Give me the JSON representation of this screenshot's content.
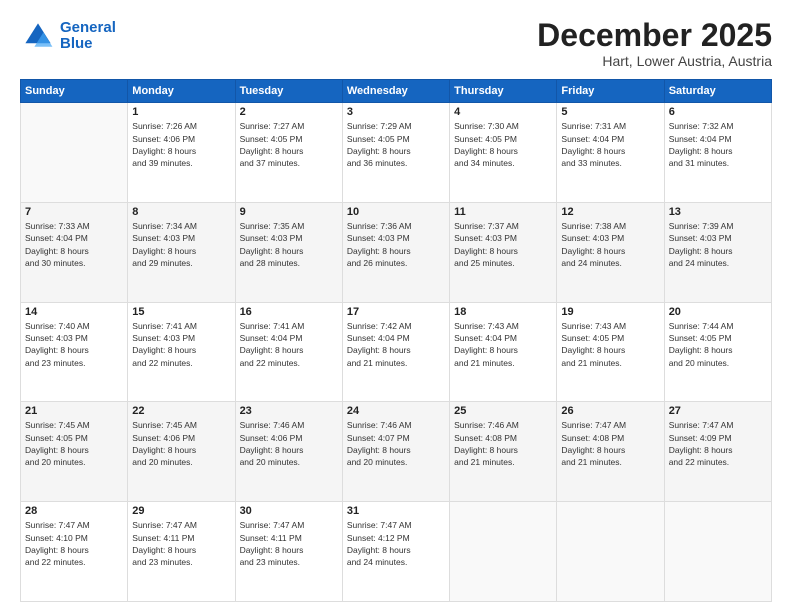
{
  "logo": {
    "line1": "General",
    "line2": "Blue"
  },
  "header": {
    "month": "December 2025",
    "location": "Hart, Lower Austria, Austria"
  },
  "weekdays": [
    "Sunday",
    "Monday",
    "Tuesday",
    "Wednesday",
    "Thursday",
    "Friday",
    "Saturday"
  ],
  "weeks": [
    [
      {
        "day": "",
        "info": ""
      },
      {
        "day": "1",
        "info": "Sunrise: 7:26 AM\nSunset: 4:06 PM\nDaylight: 8 hours\nand 39 minutes."
      },
      {
        "day": "2",
        "info": "Sunrise: 7:27 AM\nSunset: 4:05 PM\nDaylight: 8 hours\nand 37 minutes."
      },
      {
        "day": "3",
        "info": "Sunrise: 7:29 AM\nSunset: 4:05 PM\nDaylight: 8 hours\nand 36 minutes."
      },
      {
        "day": "4",
        "info": "Sunrise: 7:30 AM\nSunset: 4:05 PM\nDaylight: 8 hours\nand 34 minutes."
      },
      {
        "day": "5",
        "info": "Sunrise: 7:31 AM\nSunset: 4:04 PM\nDaylight: 8 hours\nand 33 minutes."
      },
      {
        "day": "6",
        "info": "Sunrise: 7:32 AM\nSunset: 4:04 PM\nDaylight: 8 hours\nand 31 minutes."
      }
    ],
    [
      {
        "day": "7",
        "info": "Sunrise: 7:33 AM\nSunset: 4:04 PM\nDaylight: 8 hours\nand 30 minutes."
      },
      {
        "day": "8",
        "info": "Sunrise: 7:34 AM\nSunset: 4:03 PM\nDaylight: 8 hours\nand 29 minutes."
      },
      {
        "day": "9",
        "info": "Sunrise: 7:35 AM\nSunset: 4:03 PM\nDaylight: 8 hours\nand 28 minutes."
      },
      {
        "day": "10",
        "info": "Sunrise: 7:36 AM\nSunset: 4:03 PM\nDaylight: 8 hours\nand 26 minutes."
      },
      {
        "day": "11",
        "info": "Sunrise: 7:37 AM\nSunset: 4:03 PM\nDaylight: 8 hours\nand 25 minutes."
      },
      {
        "day": "12",
        "info": "Sunrise: 7:38 AM\nSunset: 4:03 PM\nDaylight: 8 hours\nand 24 minutes."
      },
      {
        "day": "13",
        "info": "Sunrise: 7:39 AM\nSunset: 4:03 PM\nDaylight: 8 hours\nand 24 minutes."
      }
    ],
    [
      {
        "day": "14",
        "info": "Sunrise: 7:40 AM\nSunset: 4:03 PM\nDaylight: 8 hours\nand 23 minutes."
      },
      {
        "day": "15",
        "info": "Sunrise: 7:41 AM\nSunset: 4:03 PM\nDaylight: 8 hours\nand 22 minutes."
      },
      {
        "day": "16",
        "info": "Sunrise: 7:41 AM\nSunset: 4:04 PM\nDaylight: 8 hours\nand 22 minutes."
      },
      {
        "day": "17",
        "info": "Sunrise: 7:42 AM\nSunset: 4:04 PM\nDaylight: 8 hours\nand 21 minutes."
      },
      {
        "day": "18",
        "info": "Sunrise: 7:43 AM\nSunset: 4:04 PM\nDaylight: 8 hours\nand 21 minutes."
      },
      {
        "day": "19",
        "info": "Sunrise: 7:43 AM\nSunset: 4:05 PM\nDaylight: 8 hours\nand 21 minutes."
      },
      {
        "day": "20",
        "info": "Sunrise: 7:44 AM\nSunset: 4:05 PM\nDaylight: 8 hours\nand 20 minutes."
      }
    ],
    [
      {
        "day": "21",
        "info": "Sunrise: 7:45 AM\nSunset: 4:05 PM\nDaylight: 8 hours\nand 20 minutes."
      },
      {
        "day": "22",
        "info": "Sunrise: 7:45 AM\nSunset: 4:06 PM\nDaylight: 8 hours\nand 20 minutes."
      },
      {
        "day": "23",
        "info": "Sunrise: 7:46 AM\nSunset: 4:06 PM\nDaylight: 8 hours\nand 20 minutes."
      },
      {
        "day": "24",
        "info": "Sunrise: 7:46 AM\nSunset: 4:07 PM\nDaylight: 8 hours\nand 20 minutes."
      },
      {
        "day": "25",
        "info": "Sunrise: 7:46 AM\nSunset: 4:08 PM\nDaylight: 8 hours\nand 21 minutes."
      },
      {
        "day": "26",
        "info": "Sunrise: 7:47 AM\nSunset: 4:08 PM\nDaylight: 8 hours\nand 21 minutes."
      },
      {
        "day": "27",
        "info": "Sunrise: 7:47 AM\nSunset: 4:09 PM\nDaylight: 8 hours\nand 22 minutes."
      }
    ],
    [
      {
        "day": "28",
        "info": "Sunrise: 7:47 AM\nSunset: 4:10 PM\nDaylight: 8 hours\nand 22 minutes."
      },
      {
        "day": "29",
        "info": "Sunrise: 7:47 AM\nSunset: 4:11 PM\nDaylight: 8 hours\nand 23 minutes."
      },
      {
        "day": "30",
        "info": "Sunrise: 7:47 AM\nSunset: 4:11 PM\nDaylight: 8 hours\nand 23 minutes."
      },
      {
        "day": "31",
        "info": "Sunrise: 7:47 AM\nSunset: 4:12 PM\nDaylight: 8 hours\nand 24 minutes."
      },
      {
        "day": "",
        "info": ""
      },
      {
        "day": "",
        "info": ""
      },
      {
        "day": "",
        "info": ""
      }
    ]
  ]
}
